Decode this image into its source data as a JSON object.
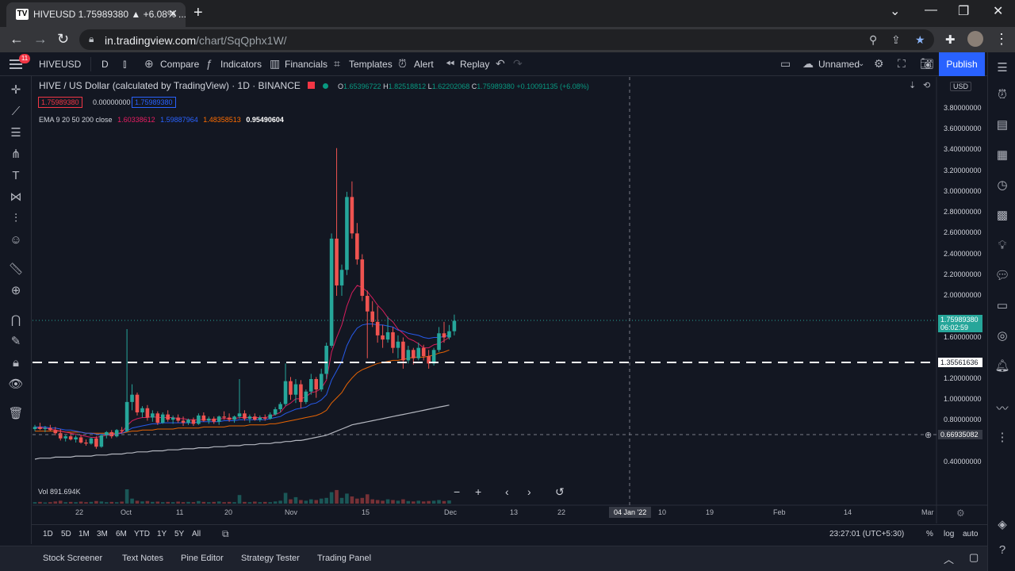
{
  "browser": {
    "tab_title": "HIVEUSD 1.75989380 ▲ +6.08% ...",
    "tab_favicon": "TV",
    "url_host": "in.tradingview.com",
    "url_path": "/chart/SqQphx1W/"
  },
  "toolbar": {
    "notifications": "11",
    "symbol": "HIVEUSD",
    "interval": "D",
    "compare": "Compare",
    "indicators": "Indicators",
    "financials": "Financials",
    "templates": "Templates",
    "alert": "Alert",
    "replay": "Replay",
    "layout_name": "Unnamed",
    "publish": "Publish"
  },
  "legend": {
    "title": "HIVE / US Dollar (calculated by TradingView) · 1D · BINANCE",
    "o_label": "O",
    "open": "1.65396722",
    "h_label": "H",
    "high": "1.82518812",
    "l_label": "L",
    "low": "1.62202068",
    "c_label": "C",
    "close": "1.75989380",
    "change": "+0.10091135 (+6.08%)",
    "bid": "1.75989380",
    "spread": "0.00000000",
    "ask": "1.75989380",
    "ema_label": "EMA 9 20 50 200 close",
    "ema9": "1.60338612",
    "ema20": "1.59887964",
    "ema50": "1.48358513",
    "ema200": "0.95490604"
  },
  "price_axis": {
    "currency": "USD",
    "labels": [
      "3.80000000",
      "3.60000000",
      "3.40000000",
      "3.20000000",
      "3.00000000",
      "2.80000000",
      "2.60000000",
      "2.40000000",
      "2.20000000",
      "2.00000000",
      "1.60000000",
      "1.20000000",
      "1.00000000",
      "0.80000000",
      "0.40000000"
    ],
    "last_price": "1.75989380",
    "countdown": "06:02:59",
    "line_price": "1.35561636",
    "cursor_price": "0.66935082"
  },
  "time_axis": {
    "labels": [
      "22",
      "Oct",
      "11",
      "20",
      "Nov",
      "15",
      "Dec",
      "13",
      "22",
      "10",
      "19",
      "Feb",
      "14",
      "Mar"
    ],
    "cursor_date": "04 Jan '22"
  },
  "volume": {
    "label": "Vol",
    "value": "891.694K"
  },
  "ranges": [
    "1D",
    "5D",
    "1M",
    "3M",
    "6M",
    "YTD",
    "1Y",
    "5Y",
    "All"
  ],
  "status": {
    "clock": "23:27:01 (UTC+5:30)",
    "percent": "%",
    "log": "log",
    "auto": "auto"
  },
  "panels": [
    "Stock Screener",
    "Text Notes",
    "Pine Editor",
    "Strategy Tester",
    "Trading Panel"
  ],
  "colors": {
    "up": "#26a69a",
    "down": "#ef5350",
    "bg": "#131722",
    "accent": "#2962ff",
    "ema9": "#e91e63",
    "ema20": "#2962ff",
    "ema50": "#ff6d00",
    "ema200": "#d1d4dc"
  },
  "chart_data": {
    "type": "candlestick",
    "ylim": [
      0.3,
      4.05
    ],
    "candles": [
      [
        0.72,
        0.76,
        0.7,
        0.74
      ],
      [
        0.74,
        0.78,
        0.71,
        0.72
      ],
      [
        0.72,
        0.75,
        0.69,
        0.73
      ],
      [
        0.73,
        0.76,
        0.7,
        0.71
      ],
      [
        0.71,
        0.74,
        0.66,
        0.68
      ],
      [
        0.68,
        0.72,
        0.61,
        0.63
      ],
      [
        0.63,
        0.66,
        0.6,
        0.65
      ],
      [
        0.65,
        0.68,
        0.61,
        0.62
      ],
      [
        0.62,
        0.66,
        0.59,
        0.64
      ],
      [
        0.64,
        0.66,
        0.58,
        0.59
      ],
      [
        0.59,
        0.62,
        0.56,
        0.58
      ],
      [
        0.58,
        0.64,
        0.57,
        0.63
      ],
      [
        0.63,
        0.65,
        0.53,
        0.55
      ],
      [
        0.55,
        0.67,
        0.54,
        0.66
      ],
      [
        0.66,
        0.7,
        0.63,
        0.69
      ],
      [
        0.69,
        0.71,
        0.63,
        0.65
      ],
      [
        0.65,
        0.72,
        0.64,
        0.71
      ],
      [
        0.71,
        0.74,
        0.68,
        0.7
      ],
      [
        0.7,
        1.68,
        0.69,
        0.98
      ],
      [
        0.98,
        1.15,
        0.9,
        1.05
      ],
      [
        1.05,
        1.07,
        0.85,
        0.88
      ],
      [
        0.88,
        0.94,
        0.83,
        0.92
      ],
      [
        0.92,
        0.95,
        0.8,
        0.83
      ],
      [
        0.83,
        0.9,
        0.79,
        0.87
      ],
      [
        0.87,
        0.89,
        0.76,
        0.78
      ],
      [
        0.78,
        0.88,
        0.77,
        0.86
      ],
      [
        0.86,
        0.9,
        0.79,
        0.81
      ],
      [
        0.81,
        0.85,
        0.77,
        0.83
      ],
      [
        0.83,
        0.86,
        0.78,
        0.8
      ],
      [
        0.8,
        0.84,
        0.75,
        0.78
      ],
      [
        0.78,
        0.82,
        0.76,
        0.81
      ],
      [
        0.81,
        0.83,
        0.75,
        0.77
      ],
      [
        0.77,
        0.87,
        0.76,
        0.85
      ],
      [
        0.85,
        0.88,
        0.79,
        0.8
      ],
      [
        0.8,
        0.84,
        0.77,
        0.82
      ],
      [
        0.82,
        0.84,
        0.77,
        0.79
      ],
      [
        0.79,
        0.85,
        0.76,
        0.84
      ],
      [
        0.84,
        0.89,
        0.81,
        0.83
      ],
      [
        0.83,
        0.87,
        0.79,
        0.81
      ],
      [
        0.81,
        0.85,
        0.78,
        0.84
      ],
      [
        0.84,
        1.2,
        0.82,
        0.87
      ],
      [
        0.87,
        0.9,
        0.8,
        0.82
      ],
      [
        0.82,
        0.86,
        0.78,
        0.84
      ],
      [
        0.84,
        0.87,
        0.8,
        0.81
      ],
      [
        0.81,
        0.85,
        0.79,
        0.83
      ],
      [
        0.83,
        0.86,
        0.8,
        0.82
      ],
      [
        0.82,
        0.88,
        0.81,
        0.86
      ],
      [
        0.86,
        0.93,
        0.85,
        0.91
      ],
      [
        0.91,
        0.98,
        0.88,
        0.96
      ],
      [
        0.96,
        1.35,
        0.94,
        1.18
      ],
      [
        1.18,
        1.22,
        1.0,
        1.05
      ],
      [
        1.05,
        1.2,
        0.97,
        1.15
      ],
      [
        1.15,
        1.19,
        0.92,
        0.98
      ],
      [
        0.98,
        1.1,
        0.96,
        1.08
      ],
      [
        1.08,
        1.25,
        1.05,
        1.2
      ],
      [
        1.2,
        1.22,
        1.02,
        1.1
      ],
      [
        1.1,
        1.3,
        1.08,
        1.25
      ],
      [
        1.25,
        1.55,
        1.2,
        1.52
      ],
      [
        1.52,
        2.6,
        1.5,
        2.55
      ],
      [
        2.55,
        3.42,
        2.0,
        2.1
      ],
      [
        2.1,
        2.3,
        2.0,
        2.25
      ],
      [
        2.25,
        3.0,
        2.2,
        2.95
      ],
      [
        2.95,
        3.1,
        2.55,
        2.6
      ],
      [
        2.6,
        2.7,
        2.3,
        2.35
      ],
      [
        2.35,
        2.4,
        1.95,
        2.0
      ],
      [
        2.0,
        2.05,
        1.4,
        1.85
      ],
      [
        1.85,
        1.95,
        1.7,
        1.75
      ],
      [
        1.75,
        1.9,
        1.55,
        1.62
      ],
      [
        1.62,
        1.72,
        1.5,
        1.58
      ],
      [
        1.58,
        1.8,
        1.55,
        1.65
      ],
      [
        1.65,
        1.7,
        1.45,
        1.5
      ],
      [
        1.5,
        1.62,
        1.4,
        1.56
      ],
      [
        1.56,
        1.6,
        1.3,
        1.38
      ],
      [
        1.38,
        1.52,
        1.35,
        1.48
      ],
      [
        1.48,
        1.5,
        1.34,
        1.4
      ],
      [
        1.4,
        1.55,
        1.38,
        1.5
      ],
      [
        1.5,
        1.53,
        1.38,
        1.42
      ],
      [
        1.42,
        1.48,
        1.3,
        1.35
      ],
      [
        1.35,
        1.5,
        1.33,
        1.48
      ],
      [
        1.48,
        1.7,
        1.46,
        1.64
      ],
      [
        1.64,
        1.75,
        1.55,
        1.6
      ],
      [
        1.6,
        1.72,
        1.58,
        1.66
      ],
      [
        1.66,
        1.82,
        1.62,
        1.76
      ]
    ],
    "ema9": [
      0.73,
      0.73,
      0.73,
      0.72,
      0.71,
      0.7,
      0.69,
      0.68,
      0.67,
      0.66,
      0.65,
      0.64,
      0.64,
      0.65,
      0.66,
      0.66,
      0.67,
      0.69,
      0.75,
      0.8,
      0.82,
      0.83,
      0.83,
      0.84,
      0.83,
      0.83,
      0.83,
      0.83,
      0.82,
      0.82,
      0.81,
      0.81,
      0.81,
      0.81,
      0.81,
      0.81,
      0.82,
      0.82,
      0.82,
      0.82,
      0.83,
      0.83,
      0.83,
      0.83,
      0.83,
      0.83,
      0.84,
      0.86,
      0.88,
      0.94,
      0.97,
      1.01,
      1.01,
      1.03,
      1.07,
      1.08,
      1.11,
      1.19,
      1.46,
      1.6,
      1.72,
      1.9,
      2.03,
      2.1,
      2.08,
      2.04,
      1.98,
      1.91,
      1.86,
      1.79,
      1.75,
      1.68,
      1.64,
      1.59,
      1.57,
      1.54,
      1.5,
      1.5,
      1.53,
      1.54,
      1.57,
      1.6
    ],
    "ema20": [
      0.74,
      0.74,
      0.74,
      0.73,
      0.73,
      0.72,
      0.71,
      0.71,
      0.7,
      0.69,
      0.68,
      0.68,
      0.67,
      0.67,
      0.67,
      0.67,
      0.67,
      0.68,
      0.7,
      0.73,
      0.74,
      0.75,
      0.76,
      0.77,
      0.77,
      0.78,
      0.78,
      0.78,
      0.78,
      0.78,
      0.78,
      0.78,
      0.79,
      0.79,
      0.79,
      0.79,
      0.79,
      0.8,
      0.8,
      0.8,
      0.81,
      0.81,
      0.81,
      0.81,
      0.81,
      0.81,
      0.82,
      0.83,
      0.84,
      0.87,
      0.89,
      0.91,
      0.92,
      0.93,
      0.96,
      0.97,
      1.0,
      1.05,
      1.19,
      1.28,
      1.37,
      1.52,
      1.62,
      1.69,
      1.72,
      1.73,
      1.73,
      1.72,
      1.72,
      1.71,
      1.7,
      1.67,
      1.66,
      1.64,
      1.63,
      1.62,
      1.6,
      1.59,
      1.6,
      1.6,
      1.61,
      1.62
    ],
    "ema50": [
      0.7,
      0.7,
      0.7,
      0.7,
      0.7,
      0.7,
      0.69,
      0.69,
      0.69,
      0.69,
      0.68,
      0.68,
      0.68,
      0.68,
      0.68,
      0.68,
      0.68,
      0.68,
      0.69,
      0.7,
      0.7,
      0.71,
      0.71,
      0.71,
      0.72,
      0.72,
      0.72,
      0.72,
      0.73,
      0.73,
      0.73,
      0.73,
      0.73,
      0.74,
      0.74,
      0.74,
      0.74,
      0.74,
      0.75,
      0.75,
      0.75,
      0.75,
      0.76,
      0.76,
      0.76,
      0.76,
      0.77,
      0.77,
      0.78,
      0.79,
      0.8,
      0.81,
      0.82,
      0.83,
      0.84,
      0.85,
      0.87,
      0.9,
      0.97,
      1.02,
      1.07,
      1.15,
      1.21,
      1.26,
      1.29,
      1.31,
      1.33,
      1.35,
      1.36,
      1.37,
      1.38,
      1.38,
      1.39,
      1.4,
      1.41,
      1.41,
      1.41,
      1.42,
      1.43,
      1.45,
      1.46,
      1.48
    ],
    "ema200": [
      0.43,
      0.44,
      0.44,
      0.44,
      0.45,
      0.45,
      0.45,
      0.45,
      0.46,
      0.46,
      0.46,
      0.46,
      0.47,
      0.47,
      0.47,
      0.48,
      0.48,
      0.48,
      0.49,
      0.49,
      0.5,
      0.5,
      0.5,
      0.51,
      0.51,
      0.51,
      0.52,
      0.52,
      0.52,
      0.53,
      0.53,
      0.53,
      0.54,
      0.54,
      0.54,
      0.55,
      0.55,
      0.55,
      0.56,
      0.56,
      0.56,
      0.57,
      0.57,
      0.57,
      0.58,
      0.58,
      0.58,
      0.59,
      0.59,
      0.6,
      0.6,
      0.61,
      0.61,
      0.62,
      0.63,
      0.64,
      0.65,
      0.66,
      0.68,
      0.7,
      0.72,
      0.74,
      0.76,
      0.77,
      0.78,
      0.79,
      0.8,
      0.81,
      0.82,
      0.83,
      0.84,
      0.85,
      0.86,
      0.87,
      0.88,
      0.89,
      0.9,
      0.91,
      0.92,
      0.93,
      0.94,
      0.95
    ],
    "volumes": [
      0.1,
      0.12,
      0.08,
      0.1,
      0.15,
      0.2,
      0.1,
      0.12,
      0.1,
      0.14,
      0.1,
      0.12,
      0.18,
      0.15,
      0.1,
      0.12,
      0.1,
      0.14,
      1.0,
      0.35,
      0.2,
      0.15,
      0.18,
      0.12,
      0.14,
      0.1,
      0.12,
      0.1,
      0.14,
      0.1,
      0.12,
      0.1,
      0.18,
      0.12,
      0.1,
      0.12,
      0.15,
      0.1,
      0.12,
      0.1,
      0.6,
      0.12,
      0.1,
      0.14,
      0.1,
      0.12,
      0.1,
      0.15,
      0.2,
      0.75,
      0.3,
      0.45,
      0.25,
      0.2,
      0.3,
      0.25,
      0.35,
      0.4,
      0.8,
      0.95,
      0.4,
      0.7,
      0.5,
      0.35,
      0.4,
      0.65,
      0.3,
      0.25,
      0.2,
      0.3,
      0.25,
      0.2,
      0.3,
      0.18,
      0.15,
      0.2,
      0.15,
      0.18,
      0.2,
      0.25,
      0.18,
      0.22
    ]
  }
}
